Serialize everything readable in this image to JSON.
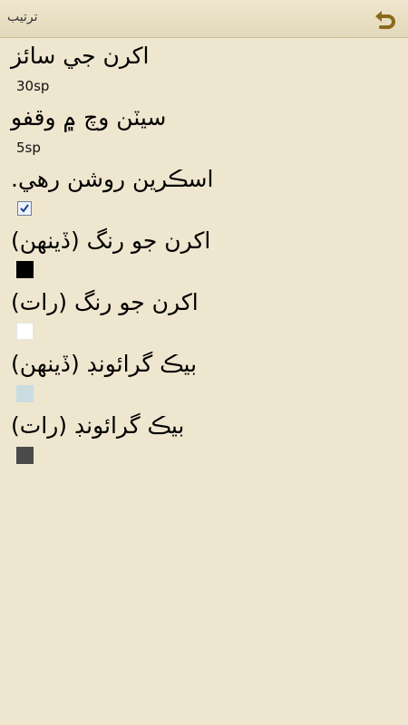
{
  "header": {
    "title": "ترتيب",
    "back_icon": "back-arrow-icon",
    "accent_color": "#8a6a1a"
  },
  "settings": {
    "items": [
      {
        "label": "اکرن جي سائز",
        "value": "30sp"
      },
      {
        "label": "سيٽن وچ ۾ وقفو",
        "value": "5sp"
      },
      {
        "label": "اسڪرين روشن رهي.",
        "checked": true
      },
      {
        "label": "اکرن جو رنگ (ڏينهن)",
        "color": "#000000"
      },
      {
        "label": "اکرن جو رنگ (رات)",
        "color": "#ffffff"
      },
      {
        "label": "بيڪ گرائونڊ (ڏينهن)",
        "color": "#c9dde0"
      },
      {
        "label": "بيڪ گرائونڊ (رات)",
        "color": "#4a4a4a"
      }
    ]
  }
}
